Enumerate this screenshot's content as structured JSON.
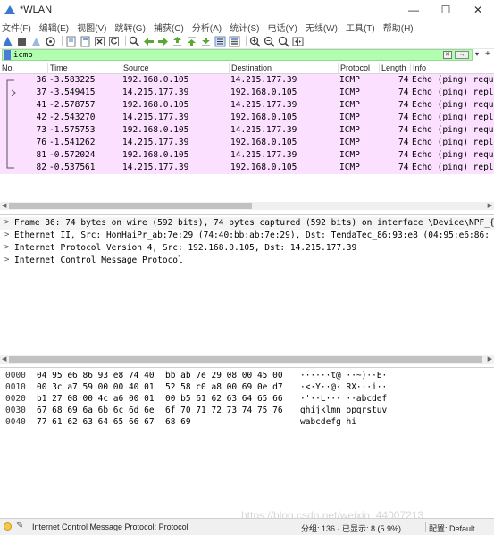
{
  "window": {
    "title": "*WLAN",
    "controls": {
      "minimize": "—",
      "maximize": "☐",
      "close": "✕"
    }
  },
  "menu": [
    "文件(F)",
    "编辑(E)",
    "视图(V)",
    "跳转(G)",
    "捕获(C)",
    "分析(A)",
    "统计(S)",
    "电话(Y)",
    "无线(W)",
    "工具(T)",
    "帮助(H)"
  ],
  "filter": {
    "value": "icmp",
    "clear_glyph": "✕",
    "apply_glyph": "→",
    "dropdown_glyph": "▾",
    "add_glyph": "+"
  },
  "packet_list": {
    "columns": [
      "No.",
      "Time",
      "Source",
      "Destination",
      "Protocol",
      "Length",
      "Info"
    ],
    "rows": [
      {
        "no": "36",
        "time": "-3.583225",
        "src": "192.168.0.105",
        "dst": "14.215.177.39",
        "proto": "ICMP",
        "len": "74",
        "info": "Echo (ping) request"
      },
      {
        "no": "37",
        "time": "-3.549415",
        "src": "14.215.177.39",
        "dst": "192.168.0.105",
        "proto": "ICMP",
        "len": "74",
        "info": "Echo (ping) reply"
      },
      {
        "no": "41",
        "time": "-2.578757",
        "src": "192.168.0.105",
        "dst": "14.215.177.39",
        "proto": "ICMP",
        "len": "74",
        "info": "Echo (ping) request"
      },
      {
        "no": "42",
        "time": "-2.543270",
        "src": "14.215.177.39",
        "dst": "192.168.0.105",
        "proto": "ICMP",
        "len": "74",
        "info": "Echo (ping) reply"
      },
      {
        "no": "73",
        "time": "-1.575753",
        "src": "192.168.0.105",
        "dst": "14.215.177.39",
        "proto": "ICMP",
        "len": "74",
        "info": "Echo (ping) request"
      },
      {
        "no": "76",
        "time": "-1.541262",
        "src": "14.215.177.39",
        "dst": "192.168.0.105",
        "proto": "ICMP",
        "len": "74",
        "info": "Echo (ping) reply"
      },
      {
        "no": "81",
        "time": "-0.572024",
        "src": "192.168.0.105",
        "dst": "14.215.177.39",
        "proto": "ICMP",
        "len": "74",
        "info": "Echo (ping) request"
      },
      {
        "no": "82",
        "time": "-0.537561",
        "src": "14.215.177.39",
        "dst": "192.168.0.105",
        "proto": "ICMP",
        "len": "74",
        "info": "Echo (ping) reply"
      }
    ]
  },
  "details": [
    "Frame 36: 74 bytes on wire (592 bits), 74 bytes captured (592 bits) on interface \\Device\\NPF_{",
    "Ethernet II, Src: HonHaiPr_ab:7e:29 (74:40:bb:ab:7e:29), Dst: TendaTec_86:93:e8 (04:95:e6:86:",
    "Internet Protocol Version 4, Src: 192.168.0.105, Dst: 14.215.177.39",
    "Internet Control Message Protocol"
  ],
  "bytes": [
    {
      "off": "0000",
      "hex1": "04 95 e6 86 93 e8 74 40",
      "hex2": "bb ab 7e 29 08 00 45 00",
      "ascii": "······t@ ··~)··E·"
    },
    {
      "off": "0010",
      "hex1": "00 3c a7 59 00 00 40 01",
      "hex2": "52 58 c0 a8 00 69 0e d7",
      "ascii": "·<·Y··@· RX···i··"
    },
    {
      "off": "0020",
      "hex1": "b1 27 08 00 4c a6 00 01",
      "hex2": "00 b5 61 62 63 64 65 66",
      "ascii": "·'··L··· ··abcdef"
    },
    {
      "off": "0030",
      "hex1": "67 68 69 6a 6b 6c 6d 6e",
      "hex2": "6f 70 71 72 73 74 75 76",
      "ascii": "ghijklmn opqrstuv"
    },
    {
      "off": "0040",
      "hex1": "77 61 62 63 64 65 66 67",
      "hex2": "68 69",
      "ascii": "wabcdefg hi"
    }
  ],
  "status": {
    "field_text": "Internet Control Message Protocol: Protocol",
    "stats": "分组: 136 · 已显示: 8 (5.9%)",
    "profile": "配置: Default"
  },
  "watermark": "https://blog.csdn.net/weixin_44007213",
  "colors": {
    "filter_bg": "#afffaf",
    "row_bg": "#fce0ff",
    "title_icon": "#3b78d0"
  }
}
